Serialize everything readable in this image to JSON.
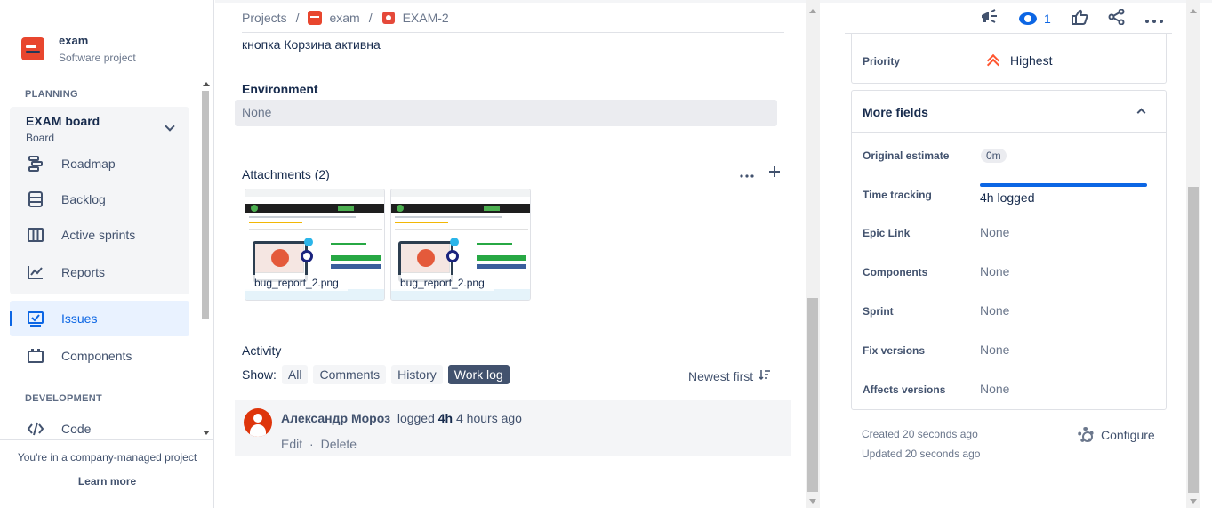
{
  "sidebar": {
    "project_name": "exam",
    "project_type": "Software project",
    "planning_title": "PLANNING",
    "board_title": "EXAM board",
    "board_sub": "Board",
    "items": [
      {
        "label": "Roadmap",
        "icon": "roadmap-icon"
      },
      {
        "label": "Backlog",
        "icon": "backlog-icon"
      },
      {
        "label": "Active sprints",
        "icon": "sprints-icon"
      },
      {
        "label": "Reports",
        "icon": "reports-icon"
      },
      {
        "label": "Issues",
        "icon": "issues-icon",
        "active": true
      },
      {
        "label": "Components",
        "icon": "components-icon"
      }
    ],
    "development_title": "DEVELOPMENT",
    "code_label": "Code",
    "footer_text": "You're in a company-managed project",
    "footer_link": "Learn more"
  },
  "breadcrumb": {
    "projects": "Projects",
    "sep": "/",
    "project": "exam",
    "issue": "EXAM-2"
  },
  "issue": {
    "description_tail": "кнопка Корзина активна",
    "environment_label": "Environment",
    "environment_value": "None",
    "attachments_label": "Attachments (2)",
    "attachments": [
      {
        "name": "bug_report_2.png"
      },
      {
        "name": "bug_report_2.png"
      }
    ]
  },
  "activity": {
    "title": "Activity",
    "show_label": "Show:",
    "filters": [
      "All",
      "Comments",
      "History",
      "Work log"
    ],
    "active_filter": "Work log",
    "sort_label": "Newest first",
    "entries": [
      {
        "user": "Александр Мороз",
        "action": "logged",
        "duration": "4h",
        "time": "4 hours ago",
        "edit": "Edit",
        "dot": "·",
        "delete": "Delete"
      }
    ]
  },
  "right_panel": {
    "watch_count": "1",
    "priority_label": "Priority",
    "priority_value": "Highest",
    "more_fields_title": "More fields",
    "fields": {
      "original_estimate_label": "Original estimate",
      "original_estimate_value": "0m",
      "time_tracking_label": "Time tracking",
      "time_tracking_value": "4h logged",
      "time_tracking_progress": 1.0,
      "epic_link_label": "Epic Link",
      "epic_link_value": "None",
      "components_label": "Components",
      "components_value": "None",
      "sprint_label": "Sprint",
      "sprint_value": "None",
      "fix_versions_label": "Fix versions",
      "fix_versions_value": "None",
      "affects_versions_label": "Affects versions",
      "affects_versions_value": "None"
    },
    "created": "Created 20 seconds ago",
    "updated": "Updated 20 seconds ago",
    "configure_label": "Configure"
  },
  "colors": {
    "accent": "#0C66E4",
    "project_logo": "#E8462E",
    "bug": "#E5493A",
    "priority_highest": "#FF5630",
    "avatar": "#DE350B"
  }
}
